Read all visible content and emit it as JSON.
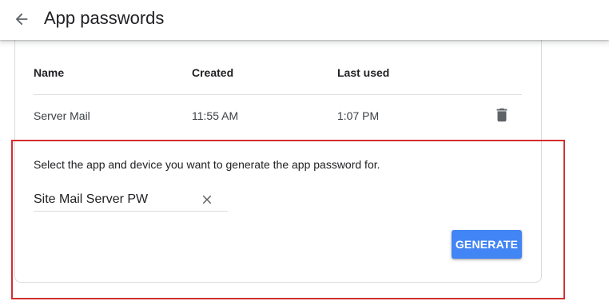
{
  "header": {
    "title": "App passwords",
    "back_icon": "arrow-back-icon"
  },
  "table": {
    "columns": [
      "Name",
      "Created",
      "Last used"
    ],
    "rows": [
      {
        "name": "Server Mail",
        "created": "11:55 AM",
        "last_used": "1:07 PM",
        "action_icon": "trash-icon"
      }
    ]
  },
  "generate": {
    "instructions": "Select the app and device you want to generate the app password for.",
    "input_value": "Site Mail Server PW",
    "clear_icon": "close-icon",
    "button_label": "GENERATE"
  },
  "colors": {
    "accent": "#4285f4",
    "highlight": "#d32f2f",
    "text": "#202124",
    "icon": "#5f6368"
  }
}
